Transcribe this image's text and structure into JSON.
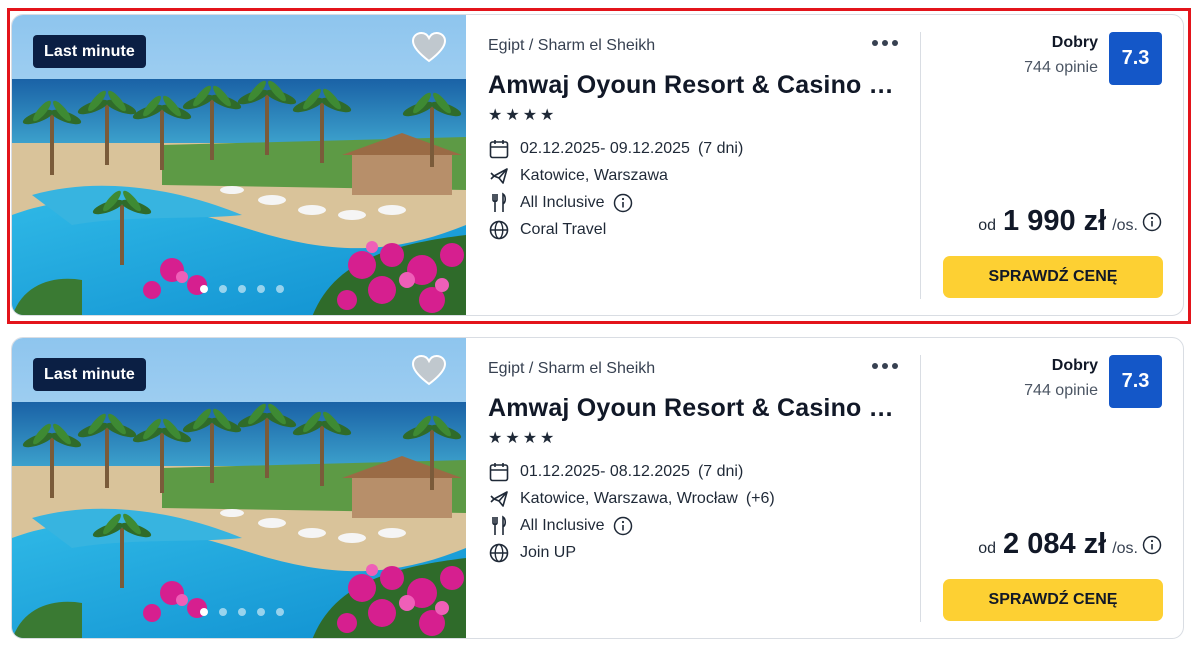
{
  "offers": [
    {
      "badge": "Last minute",
      "location": "Egipt / Sharm el Sheikh",
      "hotel_name": "Amwaj Oyoun Resort & Casino (…",
      "stars": 4,
      "dates": "02.12.2025- 09.12.2025",
      "duration": "(7 dni)",
      "departures": "Katowice, Warszawa",
      "departures_extra": "",
      "board": "All Inclusive",
      "operator": "Coral Travel",
      "rating_label": "Dobry",
      "rating_count": "744 opinie",
      "rating_score": "7.3",
      "price_from": "od",
      "price": "1 990 zł",
      "price_unit": "/os.",
      "cta_label": "SPRAWDŹ CENĘ",
      "photo_count": 5,
      "active_photo": 1
    },
    {
      "badge": "Last minute",
      "location": "Egipt / Sharm el Sheikh",
      "hotel_name": "Amwaj Oyoun Resort & Casino (…",
      "stars": 4,
      "dates": "01.12.2025- 08.12.2025",
      "duration": "(7 dni)",
      "departures": "Katowice, Warszawa, Wrocław",
      "departures_extra": "(+6)",
      "board": "All Inclusive",
      "operator": "Join UP",
      "rating_label": "Dobry",
      "rating_count": "744 opinie",
      "rating_score": "7.3",
      "price_from": "od",
      "price": "2 084 zł",
      "price_unit": "/os.",
      "cta_label": "SPRAWDŹ CENĘ",
      "photo_count": 5,
      "active_photo": 1
    }
  ],
  "colors": {
    "badge_bg": "#0b1f44",
    "score_bg": "#1457c8",
    "cta_bg": "#fdd033",
    "highlight_border": "#e3141b"
  },
  "icons": [
    "heart-icon",
    "more-options-icon",
    "calendar-icon",
    "plane-icon",
    "cutlery-icon",
    "info-icon",
    "globe-icon",
    "star-icon"
  ]
}
